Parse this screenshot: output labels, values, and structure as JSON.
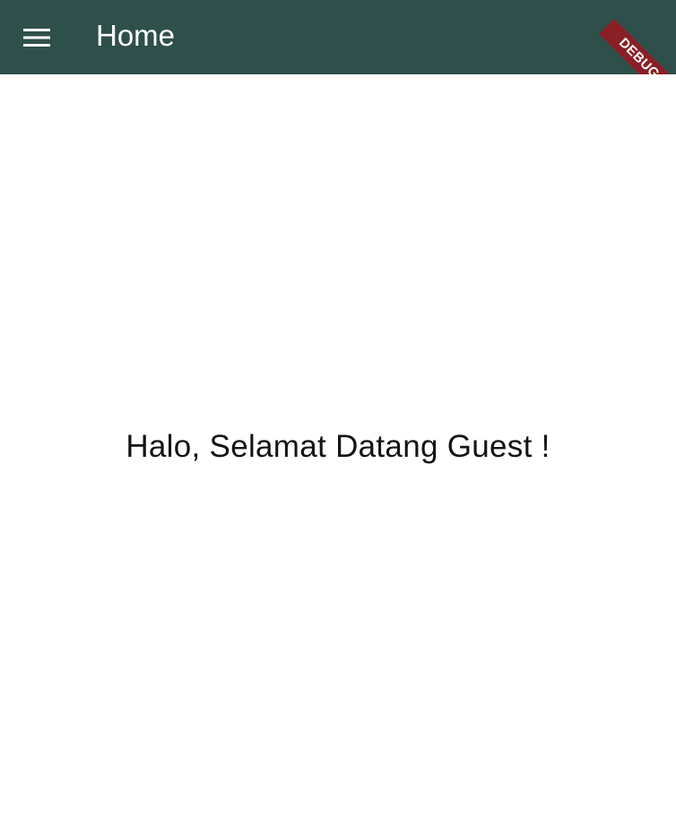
{
  "app_bar": {
    "title": "Home",
    "menu_icon": "hamburger-menu-icon",
    "background_color": "#2f4f4a"
  },
  "debug_banner": {
    "label": "DEBUG",
    "color": "#8a1f26"
  },
  "main": {
    "welcome_text": "Halo, Selamat Datang Guest !"
  }
}
